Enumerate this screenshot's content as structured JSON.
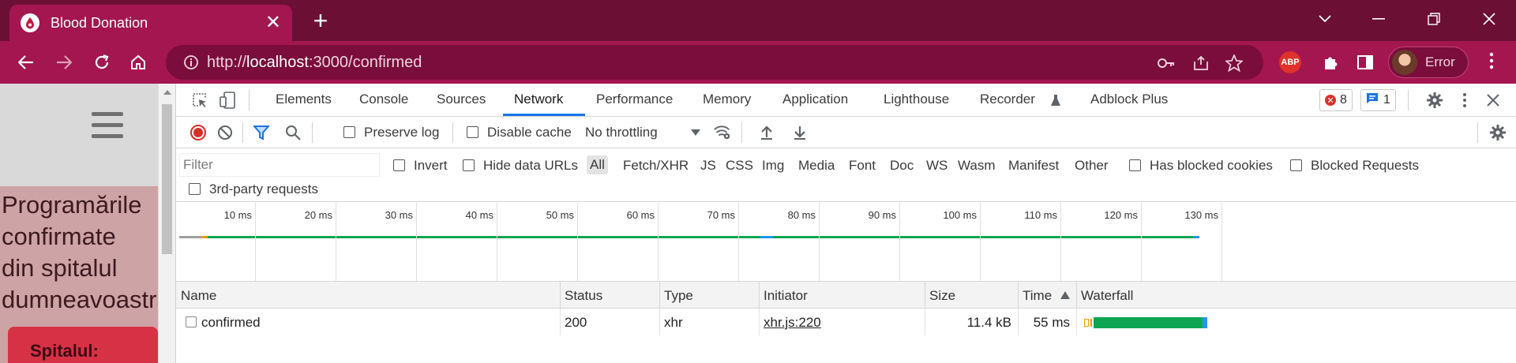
{
  "browser": {
    "tab": {
      "title": "Blood Donation"
    },
    "address": {
      "scheme": "http://",
      "host": "localhost",
      "rest": ":3000/confirmed"
    },
    "profile": {
      "label": "Error"
    },
    "abp_label": "ABP"
  },
  "page": {
    "heading": [
      "Programările",
      "confirmate",
      "din spitalul",
      "dumneavoastră"
    ],
    "hospital_label": "Spitalul:"
  },
  "devtools": {
    "tabs": [
      "Elements",
      "Console",
      "Sources",
      "Network",
      "Performance",
      "Memory",
      "Application",
      "Lighthouse",
      "Recorder",
      "Adblock Plus"
    ],
    "active_tab": "Network",
    "errors_count": "8",
    "messages_count": "1",
    "network_toolbar": {
      "preserve_log": "Preserve log",
      "disable_cache": "Disable cache",
      "throttling": "No throttling"
    },
    "filter": {
      "placeholder": "Filter",
      "invert": "Invert",
      "hide_data_urls": "Hide data URLs",
      "types": [
        "All",
        "Fetch/XHR",
        "JS",
        "CSS",
        "Img",
        "Media",
        "Font",
        "Doc",
        "WS",
        "Wasm",
        "Manifest",
        "Other"
      ],
      "has_blocked_cookies": "Has blocked cookies",
      "blocked_requests": "Blocked Requests",
      "third_party": "3rd-party requests"
    },
    "timeline_ticks": [
      "10 ms",
      "20 ms",
      "30 ms",
      "40 ms",
      "50 ms",
      "60 ms",
      "70 ms",
      "80 ms",
      "90 ms",
      "100 ms",
      "110 ms",
      "120 ms",
      "130 ms"
    ],
    "table": {
      "columns": [
        "Name",
        "Status",
        "Type",
        "Initiator",
        "Size",
        "Time",
        "Waterfall"
      ],
      "rows": [
        {
          "name": "confirmed",
          "status": "200",
          "type": "xhr",
          "initiator": "xhr.js:220",
          "size": "11.4 kB",
          "time": "55 ms"
        }
      ]
    }
  },
  "colors": {
    "tabstrip": "#6b0f35",
    "toolbar": "#a4164f",
    "accent_blue": "#1a73e8",
    "waiting_green": "#0fa653",
    "download_blue": "#2196f3"
  }
}
